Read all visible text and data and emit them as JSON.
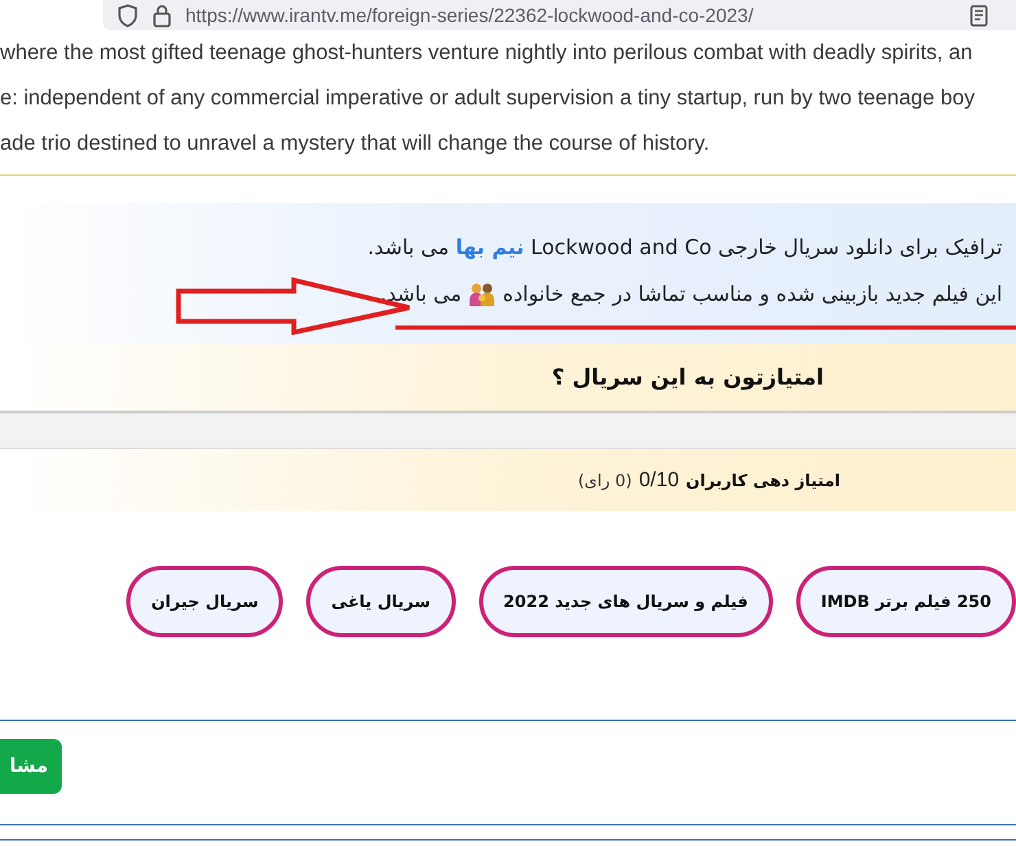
{
  "address_bar": {
    "url": "https://www.irantv.me/foreign-series/22362-lockwood-and-co-2023/"
  },
  "description_lines": [
    "where the most gifted teenage ghost-hunters venture nightly into perilous combat with deadly spirits, an",
    "e: independent of any commercial imperative or adult supervision a tiny startup, run by two teenage boy",
    "ade trio destined to unravel a mystery that will change the course of history."
  ],
  "notice": {
    "traffic": "ترافیک برای دانلود سریال خارجی Lockwood and Co **نیم بها** می باشد.",
    "family_before": "این فیلم جدید بازبینی شده و مناسب تماشا در جمع خانواده",
    "family_after": "می باشد."
  },
  "rating": {
    "question": "امتیازتون به این سریال ؟",
    "label": "امتیاز دهی کاربران",
    "score": "0/10",
    "votes": "(0 رای)"
  },
  "tags": [
    "250 فیلم برتر IMDB",
    "فیلم و سریال های جدید 2022",
    "سریال یاغی",
    "سریال جیران"
  ],
  "button": {
    "label": "مشا"
  }
}
